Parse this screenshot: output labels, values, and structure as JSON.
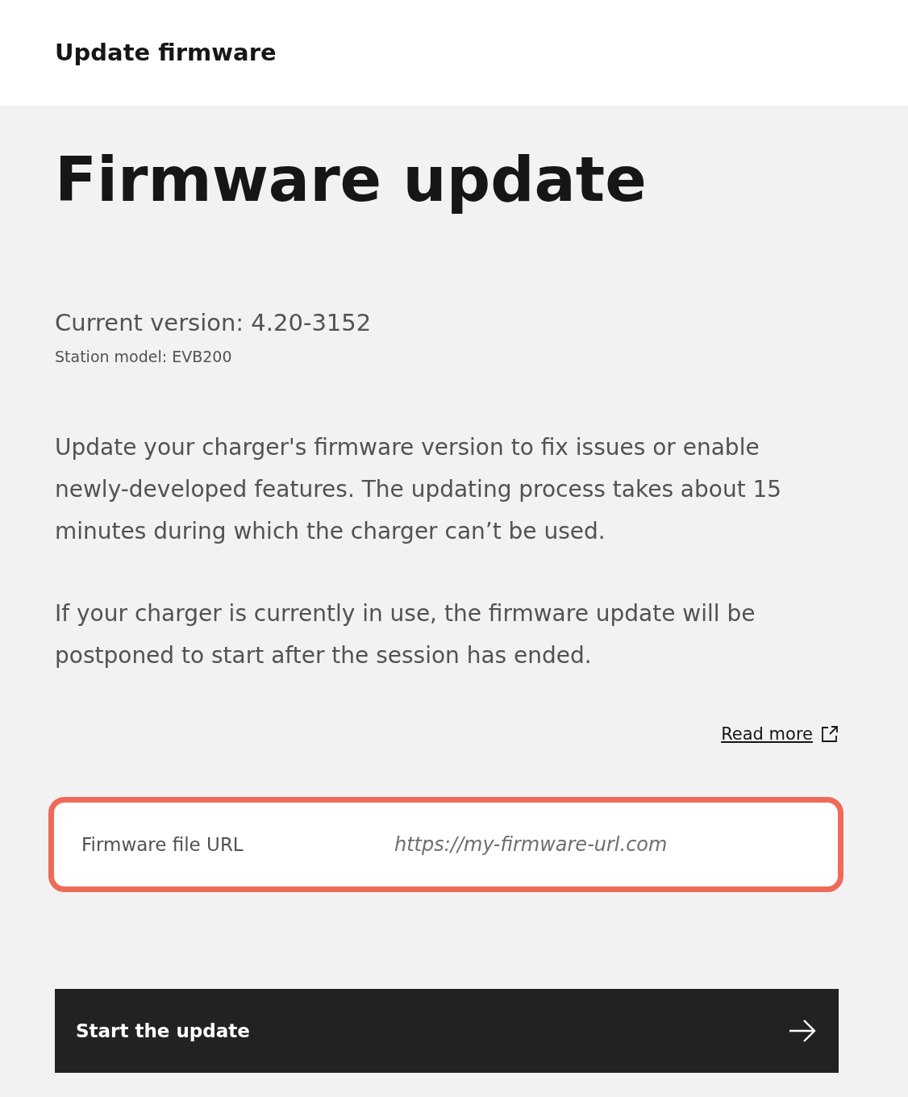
{
  "header": {
    "title": "Update firmware"
  },
  "page": {
    "heading": "Firmware update",
    "current_version": "Current version: 4.20-3152",
    "station_model": "Station model: EVB200"
  },
  "paragraphs": [
    "Update your charger's firmware version to fix issues or enable newly-developed features. The updating process takes about 15 minutes during which the charger can’t be used.",
    "If your charger is currently in use, the firmware update will be postponed to start after the session has ended."
  ],
  "read_more": {
    "label": "Read more"
  },
  "url_field": {
    "label": "Firmware file URL",
    "placeholder": "https://my-firmware-url.com",
    "highlighted": true
  },
  "start_button": {
    "label": "Start the update"
  }
}
